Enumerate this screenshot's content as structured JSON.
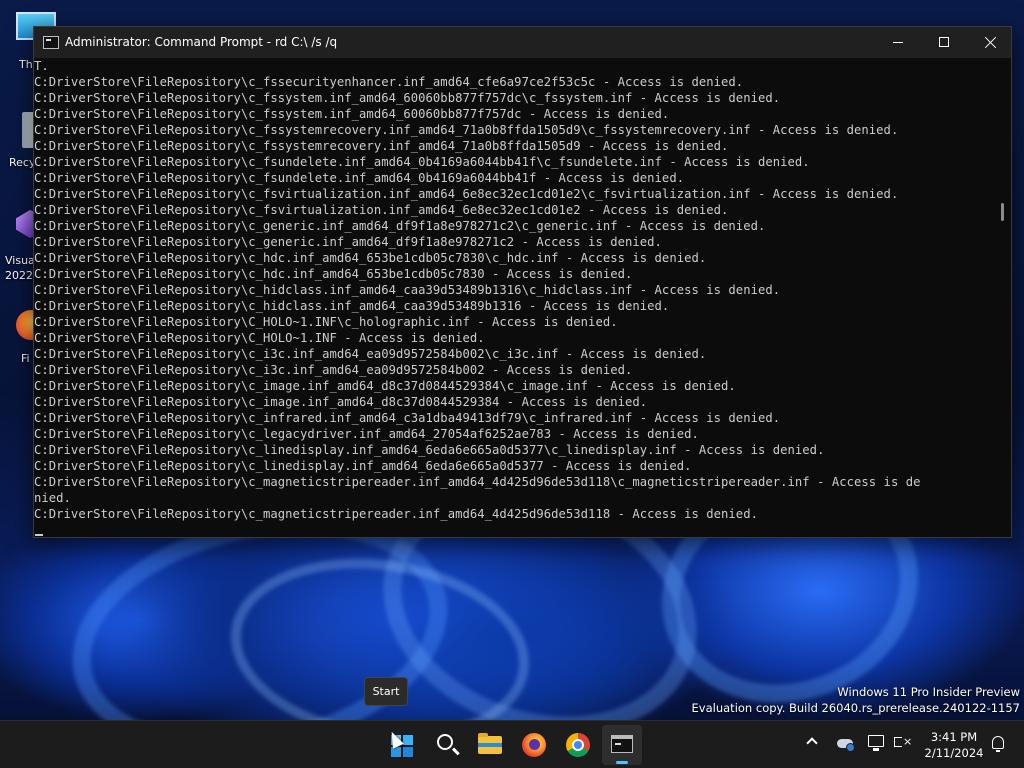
{
  "window": {
    "title": "Administrator: Command Prompt - rd  C:\\ /s /q",
    "minimize_label": "Minimize",
    "maximize_label": "Maximize",
    "close_label": "Close"
  },
  "console": {
    "first_line": "T.",
    "lines": [
      "C:DriverStore\\FileRepository\\c_fssecurityenhancer.inf_amd64_cfe6a97ce2f53c5c - Access is denied.",
      "C:DriverStore\\FileRepository\\c_fssystem.inf_amd64_60060bb877f757dc\\c_fssystem.inf - Access is denied.",
      "C:DriverStore\\FileRepository\\c_fssystem.inf_amd64_60060bb877f757dc - Access is denied.",
      "C:DriverStore\\FileRepository\\c_fssystemrecovery.inf_amd64_71a0b8ffda1505d9\\c_fssystemrecovery.inf - Access is denied.",
      "C:DriverStore\\FileRepository\\c_fssystemrecovery.inf_amd64_71a0b8ffda1505d9 - Access is denied.",
      "C:DriverStore\\FileRepository\\c_fsundelete.inf_amd64_0b4169a6044bb41f\\c_fsundelete.inf - Access is denied.",
      "C:DriverStore\\FileRepository\\c_fsundelete.inf_amd64_0b4169a6044bb41f - Access is denied.",
      "C:DriverStore\\FileRepository\\c_fsvirtualization.inf_amd64_6e8ec32ec1cd01e2\\c_fsvirtualization.inf - Access is denied.",
      "C:DriverStore\\FileRepository\\c_fsvirtualization.inf_amd64_6e8ec32ec1cd01e2 - Access is denied.",
      "C:DriverStore\\FileRepository\\c_generic.inf_amd64_df9f1a8e978271c2\\c_generic.inf - Access is denied.",
      "C:DriverStore\\FileRepository\\c_generic.inf_amd64_df9f1a8e978271c2 - Access is denied.",
      "C:DriverStore\\FileRepository\\c_hdc.inf_amd64_653be1cdb05c7830\\c_hdc.inf - Access is denied.",
      "C:DriverStore\\FileRepository\\c_hdc.inf_amd64_653be1cdb05c7830 - Access is denied.",
      "C:DriverStore\\FileRepository\\c_hidclass.inf_amd64_caa39d53489b1316\\c_hidclass.inf - Access is denied.",
      "C:DriverStore\\FileRepository\\c_hidclass.inf_amd64_caa39d53489b1316 - Access is denied.",
      "C:DriverStore\\FileRepository\\C_HOLO~1.INF\\c_holographic.inf - Access is denied.",
      "C:DriverStore\\FileRepository\\C_HOLO~1.INF - Access is denied.",
      "C:DriverStore\\FileRepository\\c_i3c.inf_amd64_ea09d9572584b002\\c_i3c.inf - Access is denied.",
      "C:DriverStore\\FileRepository\\c_i3c.inf_amd64_ea09d9572584b002 - Access is denied.",
      "C:DriverStore\\FileRepository\\c_image.inf_amd64_d8c37d0844529384\\c_image.inf - Access is denied.",
      "C:DriverStore\\FileRepository\\c_image.inf_amd64_d8c37d0844529384 - Access is denied.",
      "C:DriverStore\\FileRepository\\c_infrared.inf_amd64_c3a1dba49413df79\\c_infrared.inf - Access is denied.",
      "C:DriverStore\\FileRepository\\c_legacydriver.inf_amd64_27054af6252ae783 - Access is denied.",
      "C:DriverStore\\FileRepository\\c_linedisplay.inf_amd64_6eda6e665a0d5377\\c_linedisplay.inf - Access is denied.",
      "C:DriverStore\\FileRepository\\c_linedisplay.inf_amd64_6eda6e665a0d5377 - Access is denied.",
      "C:DriverStore\\FileRepository\\c_magneticstripereader.inf_amd64_4d425d96de53d118\\c_magneticstripereader.inf - Access is de",
      "nied.",
      "C:DriverStore\\FileRepository\\c_magneticstripereader.inf_amd64_4d425d96de53d118 - Access is denied."
    ]
  },
  "desktop_icons": [
    {
      "label": "Th",
      "icon": "monitor-icon"
    },
    {
      "label": "Recy",
      "icon": "recycle-bin-icon"
    },
    {
      "label": "Visua",
      "label2": "2022",
      "icon": "visual-studio-icon"
    },
    {
      "label": "Fi",
      "icon": "firefox-icon"
    }
  ],
  "watermark": {
    "line1": "Windows 11 Pro Insider Preview",
    "line2": "Evaluation copy. Build 26040.rs_prerelease.240122-1157"
  },
  "tooltip": {
    "text": "Start"
  },
  "taskbar": {
    "apps": [
      {
        "name": "start-button",
        "icon": "windows-logo-icon"
      },
      {
        "name": "search-button",
        "icon": "search-icon"
      },
      {
        "name": "file-explorer-button",
        "icon": "folder-icon"
      },
      {
        "name": "firefox-button",
        "icon": "firefox-icon"
      },
      {
        "name": "chrome-button",
        "icon": "chrome-icon"
      },
      {
        "name": "command-prompt-button",
        "icon": "terminal-icon"
      }
    ],
    "accent_color": "#4cc2ff"
  },
  "clock": {
    "time": "3:41 PM",
    "date": "2/11/2024"
  }
}
